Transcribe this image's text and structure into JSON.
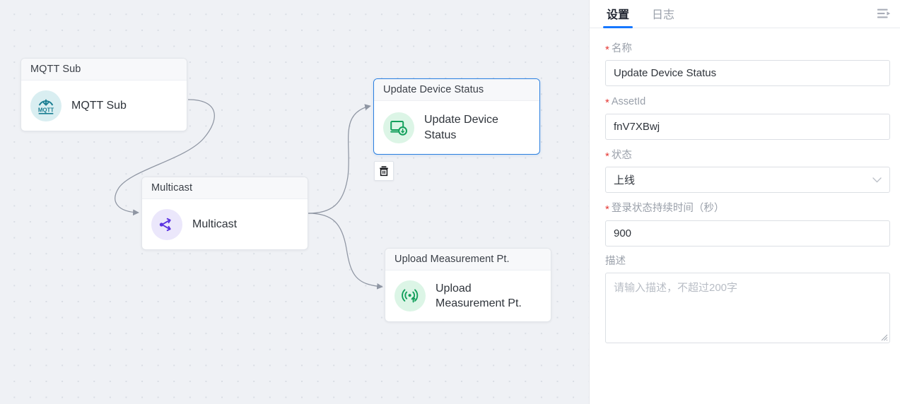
{
  "canvas": {
    "nodes": [
      {
        "id": "mqtt-sub",
        "header": "MQTT Sub",
        "label": "MQTT Sub",
        "icon": "mqtt-icon",
        "selected": false
      },
      {
        "id": "multicast",
        "header": "Multicast",
        "label": "Multicast",
        "icon": "multicast-share-icon",
        "selected": false
      },
      {
        "id": "update-device-status",
        "header": "Update Device Status",
        "label": "Update Device Status",
        "icon": "monitor-status-icon",
        "selected": true
      },
      {
        "id": "upload-measurement-pt",
        "header": "Upload Measurement Pt.",
        "label": "Upload Measurement Pt.",
        "icon": "signal-upload-icon",
        "selected": false
      }
    ],
    "delete_button": {
      "icon": "trash-icon",
      "title": "删除"
    }
  },
  "panel": {
    "tabs": [
      {
        "label": "设置",
        "active": true
      },
      {
        "label": "日志",
        "active": false
      }
    ],
    "collapse_icon": "collapse-panel-icon",
    "fields": [
      {
        "label": "名称",
        "required": true,
        "type": "text",
        "value": "Update Device Status"
      },
      {
        "label": "AssetId",
        "required": true,
        "type": "text",
        "value": "fnV7XBwj"
      },
      {
        "label": "状态",
        "required": true,
        "type": "select",
        "value": "上线",
        "chevron": "∨"
      },
      {
        "label": "登录状态持续时间（秒）",
        "required": true,
        "type": "text",
        "value": "900"
      },
      {
        "label": "描述",
        "required": false,
        "type": "textarea",
        "value": "",
        "placeholder": "请输入描述，不超过200字"
      }
    ]
  },
  "colors": {
    "accent": "#1677ff",
    "selected_border": "#2a7fe0",
    "canvas_bg": "#eff1f5",
    "grid_dot": "#d9dde4",
    "mqtt_icon_bg": "#d9eef1",
    "multicast_icon_bg": "#ebe7fb",
    "green_icon_bg": "#dcf5e6",
    "green_icon_fg": "#13a05c",
    "multicast_icon_fg": "#5b32e0",
    "required_star": "#e53935"
  }
}
